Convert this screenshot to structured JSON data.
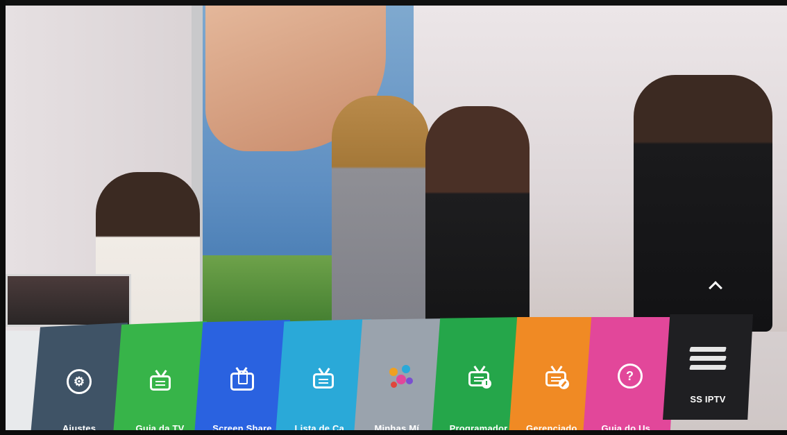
{
  "launcher": {
    "apps": [
      {
        "id": "ajustes",
        "label": "Ajustes",
        "icon": "gear-icon",
        "color": "#3f5366"
      },
      {
        "id": "guia-tv",
        "label": "Guia da TV",
        "icon": "tv-guide-icon",
        "color": "#37b449"
      },
      {
        "id": "screen-share",
        "label": "Screen Share",
        "icon": "screen-share-icon",
        "color": "#2a62e0"
      },
      {
        "id": "lista-canais",
        "label": "Lista de Ca...",
        "icon": "tv-list-icon",
        "color": "#2aa9d8"
      },
      {
        "id": "minhas-midias",
        "label": "Minhas Mí...",
        "icon": "media-nodes-icon",
        "color": "#9aa3ad"
      },
      {
        "id": "programador",
        "label": "Programador",
        "icon": "calendar-clock-icon",
        "color": "#25a64a"
      },
      {
        "id": "gerenciador",
        "label": "Gerenciado...",
        "icon": "tv-edit-icon",
        "color": "#f08a24"
      },
      {
        "id": "guia-usuario",
        "label": "Guia do Us...",
        "icon": "help-icon",
        "color": "#e2479a"
      },
      {
        "id": "ss-iptv",
        "label": "SS IPTV",
        "icon": "ss-iptv-logo-icon",
        "color": "#1f1f22"
      }
    ],
    "expand_icon": "chevron-up-icon"
  }
}
